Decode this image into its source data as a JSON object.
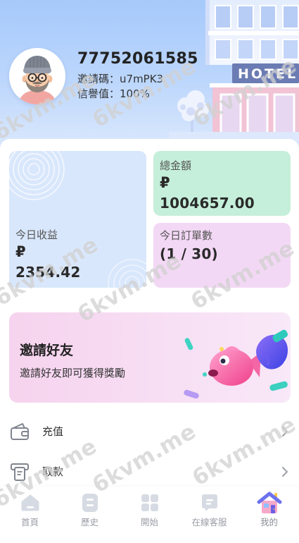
{
  "profile": {
    "user_id": "77752061585",
    "invite_code_label": "邀請碼：",
    "invite_code": "u7mPK3",
    "reputation_label": "信譽值：",
    "reputation": "100%",
    "avatar_icon": "avatar-cartoon-man",
    "header_illustration": {
      "icon": "hotel-building-illustration",
      "sign_text": "HOTEL"
    }
  },
  "stats": {
    "today_income": {
      "label": "今日收益",
      "currency": "₽",
      "value": "2354.42"
    },
    "total_amount": {
      "label": "總金額",
      "currency": "₽",
      "value": "1004657.00"
    },
    "today_orders": {
      "label": "今日訂單數",
      "value": "(1 / 30)"
    }
  },
  "invite_banner": {
    "title": "邀請好友",
    "subtitle": "邀請好友即可獲得獎勵",
    "illustration_icon": "fish-and-hand-3d-illustration"
  },
  "menu": [
    {
      "label": "充值",
      "icon": "wallet-icon",
      "trailing_icon": "chevron-right-icon"
    },
    {
      "label": "取款",
      "icon": "atm-withdraw-icon",
      "trailing_icon": "chevron-right-icon"
    }
  ],
  "tabbar": [
    {
      "label": "首頁",
      "icon": "home-icon",
      "active": false
    },
    {
      "label": "歷史",
      "icon": "history-icon",
      "active": false
    },
    {
      "label": "開始",
      "icon": "grid-start-icon",
      "active": false
    },
    {
      "label": "在線客服",
      "icon": "chat-support-icon",
      "active": false
    },
    {
      "label": "我的",
      "icon": "profile-house-icon",
      "active": true
    }
  ],
  "watermark": "6kvm.me",
  "colors": {
    "header_top": "#a6c9fb",
    "header_bottom": "#dce9fd",
    "card_income": "#d9e7fc",
    "card_total": "#c5efda",
    "card_orders": "#f3d8f5",
    "banner_start": "#f6d3ee",
    "banner_end": "#f8e8f8",
    "text_primary": "#222222",
    "text_secondary": "#555555",
    "tab_inactive": "#d6dbe3"
  }
}
